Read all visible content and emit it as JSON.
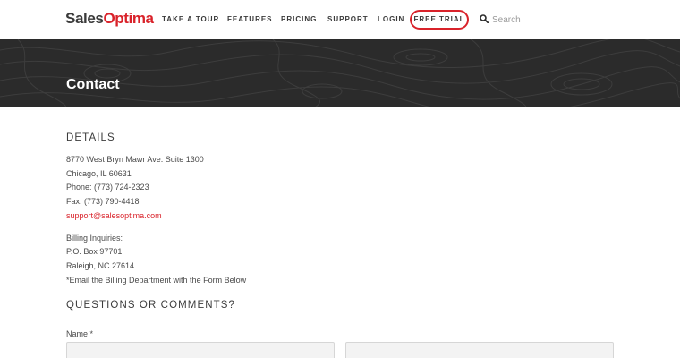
{
  "brand": {
    "part1": "Sales",
    "part2": "Optima"
  },
  "nav": {
    "items": [
      "TAKE A TOUR",
      "FEATURES",
      "PRICING",
      "SUPPORT",
      "LOGIN"
    ],
    "cta": "FREE TRIAL"
  },
  "search": {
    "placeholder": "Search",
    "icon": "search-icon"
  },
  "banner": {
    "title": "Contact"
  },
  "details": {
    "heading": "DETAILS",
    "address": [
      "8770 West Bryn Mawr Ave. Suite 1300",
      "Chicago, IL 60631"
    ],
    "phone": "Phone: (773) 724-2323",
    "fax": "Fax: (773) 790-4418",
    "email": "support@salesoptima.com",
    "billing": [
      "Billing Inquiries:",
      "P.O. Box 97701",
      "Raleigh, NC 27614",
      "*Email the Billing Department with the Form Below"
    ]
  },
  "form": {
    "heading": "QUESTIONS OR COMMENTS?",
    "name_label": "Name *"
  },
  "colors": {
    "accent": "#d9222a",
    "banner_bg": "#2b2b2b",
    "text": "#3a3a3a"
  }
}
